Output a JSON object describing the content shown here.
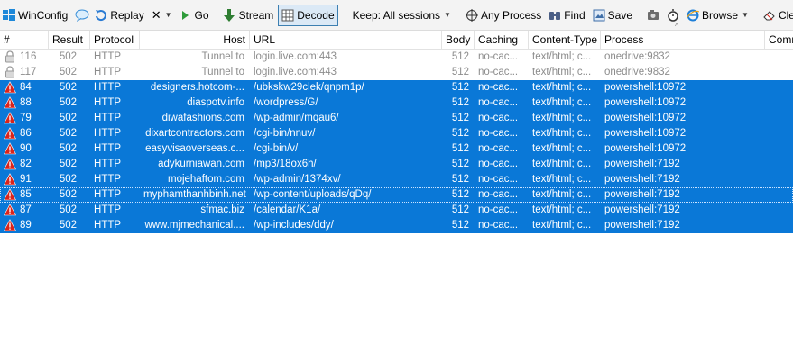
{
  "toolbar": {
    "winconfig": "WinConfig",
    "replay": "Replay",
    "remove": "✕",
    "go": "Go",
    "stream": "Stream",
    "decode": "Decode",
    "keep": "Keep: All sessions",
    "any_process": "Any Process",
    "find": "Find",
    "save": "Save",
    "browse": "Browse",
    "clear_cache": "Clear Ca"
  },
  "columns": {
    "num": "#",
    "result": "Result",
    "protocol": "Protocol",
    "host": "Host",
    "url": "URL",
    "body": "Body",
    "caching": "Caching",
    "content_type": "Content-Type",
    "process": "Process",
    "comments": "Comm"
  },
  "sessions": [
    {
      "num": "116",
      "result": "502",
      "protocol": "HTTP",
      "host": "Tunnel to",
      "url": "login.live.com:443",
      "body": "512",
      "caching": "no-cac...",
      "ctype": "text/html; c...",
      "process": "onedrive:9832",
      "icon": "lock-icon",
      "selected": false
    },
    {
      "num": "117",
      "result": "502",
      "protocol": "HTTP",
      "host": "Tunnel to",
      "url": "login.live.com:443",
      "body": "512",
      "caching": "no-cac...",
      "ctype": "text/html; c...",
      "process": "onedrive:9832",
      "icon": "lock-icon",
      "selected": false
    },
    {
      "num": "84",
      "result": "502",
      "protocol": "HTTP",
      "host": "designers.hotcom-...",
      "url": "/ubkskw29clek/qnpm1p/",
      "body": "512",
      "caching": "no-cac...",
      "ctype": "text/html; c...",
      "process": "powershell:10972",
      "icon": "warning-icon",
      "selected": true
    },
    {
      "num": "88",
      "result": "502",
      "protocol": "HTTP",
      "host": "diaspotv.info",
      "url": "/wordpress/G/",
      "body": "512",
      "caching": "no-cac...",
      "ctype": "text/html; c...",
      "process": "powershell:10972",
      "icon": "warning-icon",
      "selected": true
    },
    {
      "num": "79",
      "result": "502",
      "protocol": "HTTP",
      "host": "diwafashions.com",
      "url": "/wp-admin/mqau6/",
      "body": "512",
      "caching": "no-cac...",
      "ctype": "text/html; c...",
      "process": "powershell:10972",
      "icon": "warning-icon",
      "selected": true
    },
    {
      "num": "86",
      "result": "502",
      "protocol": "HTTP",
      "host": "dixartcontractors.com",
      "url": "/cgi-bin/nnuv/",
      "body": "512",
      "caching": "no-cac...",
      "ctype": "text/html; c...",
      "process": "powershell:10972",
      "icon": "warning-icon",
      "selected": true
    },
    {
      "num": "90",
      "result": "502",
      "protocol": "HTTP",
      "host": "easyvisaoverseas.c...",
      "url": "/cgi-bin/v/",
      "body": "512",
      "caching": "no-cac...",
      "ctype": "text/html; c...",
      "process": "powershell:10972",
      "icon": "warning-icon",
      "selected": true
    },
    {
      "num": "82",
      "result": "502",
      "protocol": "HTTP",
      "host": "adykurniawan.com",
      "url": "/mp3/18ox6h/",
      "body": "512",
      "caching": "no-cac...",
      "ctype": "text/html; c...",
      "process": "powershell:7192",
      "icon": "warning-icon",
      "selected": true
    },
    {
      "num": "91",
      "result": "502",
      "protocol": "HTTP",
      "host": "mojehaftom.com",
      "url": "/wp-admin/1374xv/",
      "body": "512",
      "caching": "no-cac...",
      "ctype": "text/html; c...",
      "process": "powershell:7192",
      "icon": "warning-icon",
      "selected": true
    },
    {
      "num": "85",
      "result": "502",
      "protocol": "HTTP",
      "host": "myphamthanhbinh.net",
      "url": "/wp-content/uploads/qDq/",
      "body": "512",
      "caching": "no-cac...",
      "ctype": "text/html; c...",
      "process": "powershell:7192",
      "icon": "warning-icon",
      "selected": true,
      "focus": true
    },
    {
      "num": "87",
      "result": "502",
      "protocol": "HTTP",
      "host": "sfmac.biz",
      "url": "/calendar/K1a/",
      "body": "512",
      "caching": "no-cac...",
      "ctype": "text/html; c...",
      "process": "powershell:7192",
      "icon": "warning-icon",
      "selected": true
    },
    {
      "num": "89",
      "result": "502",
      "protocol": "HTTP",
      "host": "www.mjmechanical....",
      "url": "/wp-includes/ddy/",
      "body": "512",
      "caching": "no-cac...",
      "ctype": "text/html; c...",
      "process": "powershell:7192",
      "icon": "warning-icon",
      "selected": true
    }
  ],
  "colors": {
    "selection": "#0a78d7",
    "warning": "#d9241b",
    "dim_text": "#8c8c8c"
  }
}
